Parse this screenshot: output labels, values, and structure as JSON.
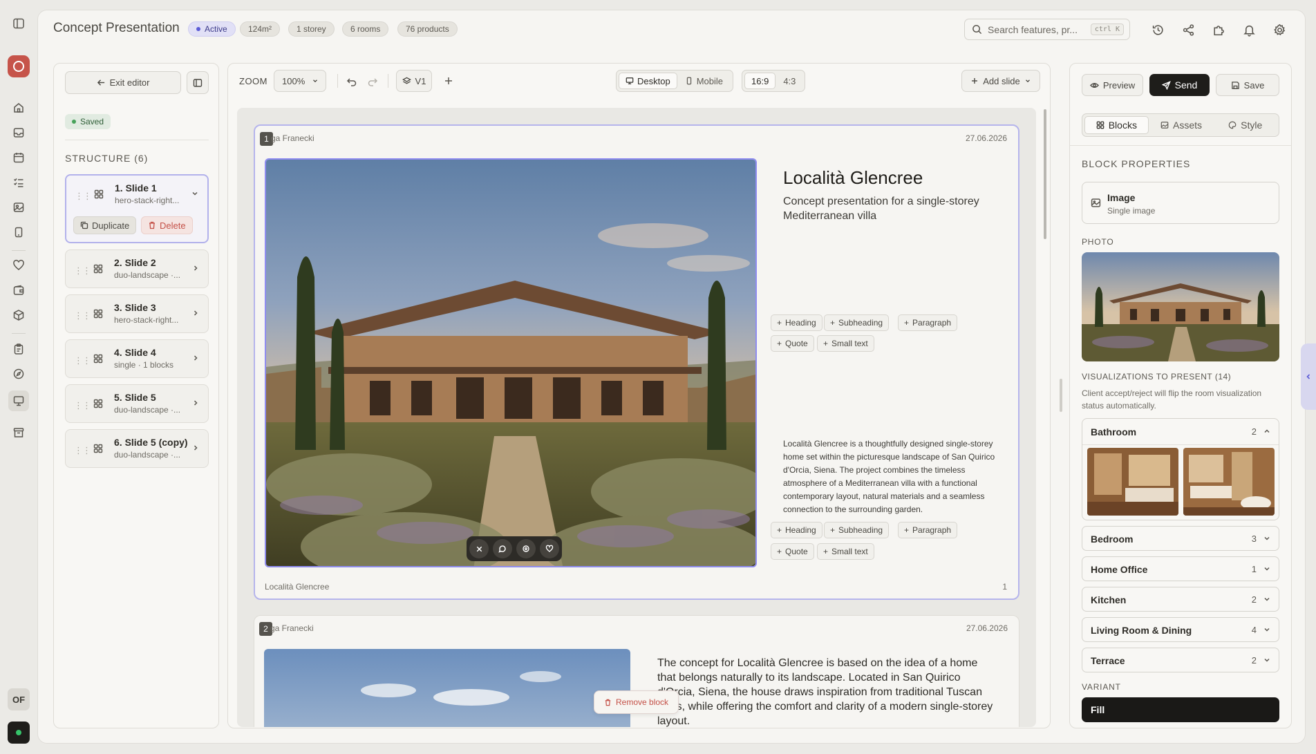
{
  "app": {
    "project_title": "Concept Presentation",
    "status": "Active",
    "tags": [
      "124m²",
      "1 storey",
      "6 rooms",
      "76 products"
    ],
    "search": {
      "placeholder": "Search features, pr...",
      "shortcut": "ctrl K"
    },
    "header_icons": [
      "history-icon",
      "share-icon",
      "puzzle-icon",
      "bell-icon",
      "settings-icon"
    ],
    "user_initials": "OF"
  },
  "left_rail": {
    "icons": [
      "sidebar-toggle-icon",
      "logo-icon",
      "home-icon",
      "inbox-icon",
      "calendar-icon",
      "checklist-icon",
      "image-icon",
      "tablet-icon",
      "heart-icon",
      "wallet-icon",
      "cube-icon",
      "clipboard-icon",
      "compass-icon",
      "presentation-icon",
      "archive-icon"
    ]
  },
  "editor": {
    "exit_label": "Exit editor",
    "saved_label": "Saved",
    "structure_label": "STRUCTURE (6)",
    "slides": [
      {
        "title": "1. Slide 1",
        "layout": "hero-stack-right...",
        "expanded": true
      },
      {
        "title": "2. Slide 2",
        "layout": "duo-landscape ·..."
      },
      {
        "title": "3. Slide 3",
        "layout": "hero-stack-right..."
      },
      {
        "title": "4. Slide 4",
        "layout": "single · 1 blocks"
      },
      {
        "title": "5. Slide 5",
        "layout": "duo-landscape ·..."
      },
      {
        "title": "6. Slide 5 (copy)",
        "layout": "duo-landscape ·..."
      }
    ],
    "duplicate_label": "Duplicate",
    "delete_label": "Delete"
  },
  "toolbar": {
    "zoom_label": "ZOOM",
    "zoom_value": "100%",
    "version": "V1",
    "device_desktop": "Desktop",
    "device_mobile": "Mobile",
    "ratio_169": "16:9",
    "ratio_43": "4:3",
    "add_slide": "Add slide"
  },
  "canvas": {
    "slide1": {
      "number": "1",
      "author": "ga Franecki",
      "date": "27.06.2026",
      "title": "Località Glencree",
      "subtitle": "Concept presentation for a single-storey Mediterranean villa",
      "paragraph": "Località Glencree is a thoughtfully designed single-storey home set within the picturesque landscape of San Quirico d'Orcia, Siena. The project combines the timeless atmosphere of a Mediterranean villa with a functional contemporary layout, natural materials and a seamless connection to the surrounding garden.",
      "footer": "Località Glencree",
      "page": "1"
    },
    "add_chips": {
      "heading": "Heading",
      "subheading": "Subheading",
      "paragraph": "Paragraph",
      "quote": "Quote",
      "small_text": "Small text"
    },
    "slide2": {
      "number": "2",
      "author": "ga Franecki",
      "date": "27.06.2026",
      "text": "The concept for Località Glencree is based on the idea of a home that belongs naturally to its landscape. Located in San Quirico d'Orcia, Siena, the house draws inspiration from traditional Tuscan villas, while offering the comfort and clarity of a modern single-storey layout."
    },
    "remove_block": "Remove block"
  },
  "right_panel": {
    "preview": "Preview",
    "send": "Send",
    "save": "Save",
    "tabs": [
      "Blocks",
      "Assets",
      "Style"
    ],
    "block_properties": "BLOCK PROPERTIES",
    "block_name": "Image",
    "block_type": "Single image",
    "photo_label": "PHOTO",
    "visualizations_label": "VISUALIZATIONS TO PRESENT (14)",
    "visualizations_note": "Client accept/reject will flip the room visualization status automatically.",
    "rooms": [
      {
        "name": "Bathroom",
        "count": "2"
      },
      {
        "name": "Bedroom",
        "count": "3"
      },
      {
        "name": "Home Office",
        "count": "1"
      },
      {
        "name": "Kitchen",
        "count": "2"
      },
      {
        "name": "Living Room & Dining",
        "count": "4"
      },
      {
        "name": "Terrace",
        "count": "2"
      }
    ],
    "variant_label": "VARIANT",
    "variant_value": "Fill"
  },
  "colors": {
    "accent": "#5b5bd6",
    "danger": "#c45047",
    "primary": "#1e1d1a",
    "success": "#47a25a"
  }
}
